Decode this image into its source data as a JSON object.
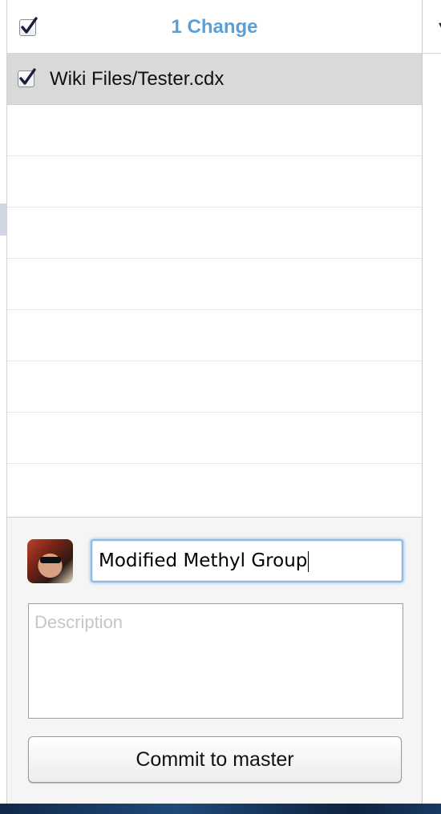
{
  "header": {
    "title": "1 Change",
    "select_all_checked": true
  },
  "file_list": {
    "files": [
      {
        "name": "Wiki Files/Tester.cdx",
        "checked": true,
        "selected": true
      }
    ]
  },
  "commit": {
    "summary_value": "Modified Methyl Group",
    "description_placeholder": "Description",
    "button_label": "Commit to master"
  },
  "colors": {
    "accent": "#5b9fd8",
    "selected_row": "#d9d9d9",
    "focus_ring": "#8fbce6"
  }
}
